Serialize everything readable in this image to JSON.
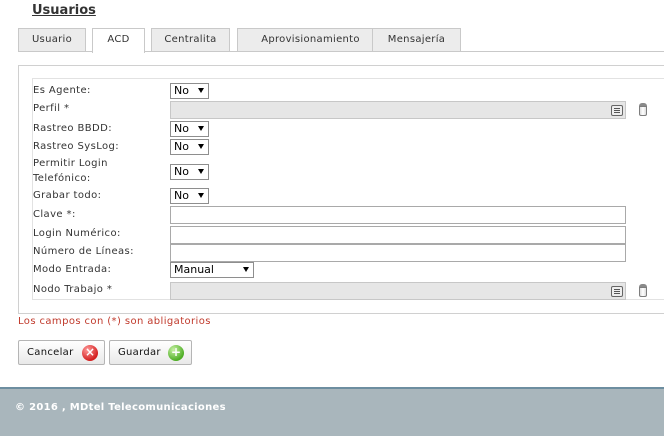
{
  "page": {
    "title": "Usuarios"
  },
  "tabs": [
    {
      "label": "Usuario"
    },
    {
      "label": "ACD"
    },
    {
      "label": "Centralita"
    },
    {
      "label": "Aprovisionamiento"
    },
    {
      "label": "Mensajería"
    }
  ],
  "form": {
    "es_agente": {
      "label": "Es Agente:",
      "value": "No"
    },
    "perfil": {
      "label": "Perfil *",
      "value": ""
    },
    "rastreo_bbdd": {
      "label": "Rastreo BBDD:",
      "value": "No"
    },
    "rastreo_syslog": {
      "label": "Rastreo SysLog:",
      "value": "No"
    },
    "permitir_login": {
      "label_line1": "Permitir Login",
      "label_line2": "Telefónico:",
      "value": "No"
    },
    "grabar_todo": {
      "label": "Grabar todo:",
      "value": "No"
    },
    "clave": {
      "label": "Clave *:",
      "value": ""
    },
    "login_numerico": {
      "label": "Login Numérico:",
      "value": ""
    },
    "numero_lineas": {
      "label": "Número de Líneas:",
      "value": ""
    },
    "modo_entrada": {
      "label": "Modo Entrada:",
      "value": "Manual"
    },
    "nodo_trabajo": {
      "label": "Nodo Trabajo *",
      "value": ""
    }
  },
  "required_note": "Los campos con (*) son abligatorios",
  "buttons": {
    "cancel_label": "Cancelar",
    "save_label": "Guardar"
  },
  "footer": {
    "text": "© 2016 , MDtel Telecomunicaciones"
  },
  "colors": {
    "required_note": "#c0392b",
    "footer_bg": "#a9b6bc",
    "cancel_icon": "#d42020",
    "save_icon": "#4fae26"
  },
  "icons": {
    "perfil_list": "list-icon",
    "perfil_delete": "trash-icon",
    "nodo_list": "list-icon",
    "nodo_delete": "trash-icon",
    "cancel": "x-circle-icon",
    "save": "plus-circle-icon"
  }
}
